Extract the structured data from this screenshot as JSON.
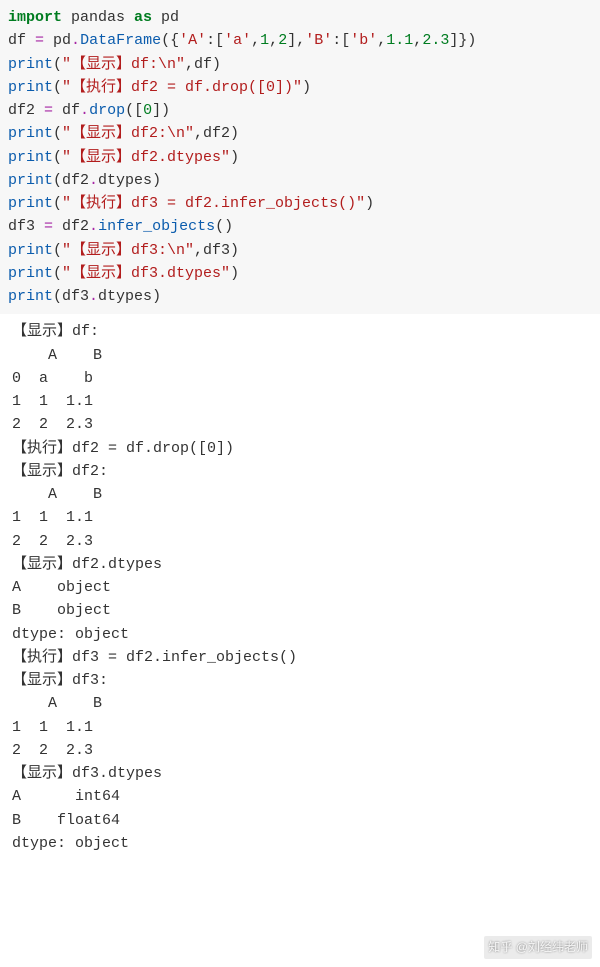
{
  "code": {
    "l1_kw1": "import",
    "l1_mod": " pandas ",
    "l1_kw2": "as",
    "l1_alias": " pd",
    "l2_a": "df ",
    "l2_eq": "=",
    "l2_b": " pd",
    "l2_dot1": ".",
    "l2_fn": "DataFrame",
    "l2_c": "({",
    "l2_s1": "'A'",
    "l2_d": ":[",
    "l2_s2": "'a'",
    "l2_e": ",",
    "l2_n1": "1",
    "l2_f": ",",
    "l2_n2": "2",
    "l2_g": "],",
    "l2_s3": "'B'",
    "l2_h": ":[",
    "l2_s4": "'b'",
    "l2_i": ",",
    "l2_n3": "1.1",
    "l2_j": ",",
    "l2_n4": "2.3",
    "l2_k": "]})",
    "l3_fn": "print",
    "l3_a": "(",
    "l3_s": "\"【显示】df:\\n\"",
    "l3_b": ",df)",
    "l4_fn": "print",
    "l4_a": "(",
    "l4_s": "\"【执行】df2 = df.drop([0])\"",
    "l4_b": ")",
    "l5_a": "df2 ",
    "l5_eq": "=",
    "l5_b": " df",
    "l5_dot": ".",
    "l5_fn": "drop",
    "l5_c": "([",
    "l5_n": "0",
    "l5_d": "])",
    "l6_fn": "print",
    "l6_a": "(",
    "l6_s": "\"【显示】df2:\\n\"",
    "l6_b": ",df2)",
    "l7_fn": "print",
    "l7_a": "(",
    "l7_s": "\"【显示】df2.dtypes\"",
    "l7_b": ")",
    "l8_fn": "print",
    "l8_a": "(df2",
    "l8_dot": ".",
    "l8_attr": "dtypes",
    "l8_b": ")",
    "l9_fn": "print",
    "l9_a": "(",
    "l9_s": "\"【执行】df3 = df2.infer_objects()\"",
    "l9_b": ")",
    "l10_a": "df3 ",
    "l10_eq": "=",
    "l10_b": " df2",
    "l10_dot": ".",
    "l10_fn": "infer_objects",
    "l10_c": "()",
    "l11_fn": "print",
    "l11_a": "(",
    "l11_s": "\"【显示】df3:\\n\"",
    "l11_b": ",df3)",
    "l12_fn": "print",
    "l12_a": "(",
    "l12_s": "\"【显示】df3.dtypes\"",
    "l12_b": ")",
    "l13_fn": "print",
    "l13_a": "(df3",
    "l13_dot": ".",
    "l13_attr": "dtypes",
    "l13_b": ")"
  },
  "output": "【显示】df:\n    A    B\n0  a    b\n1  1  1.1\n2  2  2.3\n【执行】df2 = df.drop([0])\n【显示】df2:\n    A    B\n1  1  1.1\n2  2  2.3\n【显示】df2.dtypes\nA    object\nB    object\ndtype: object\n【执行】df3 = df2.infer_objects()\n【显示】df3:\n    A    B\n1  1  1.1\n2  2  2.3\n【显示】df3.dtypes\nA      int64\nB    float64\ndtype: object",
  "watermark": "知乎 @刘经纬老师"
}
